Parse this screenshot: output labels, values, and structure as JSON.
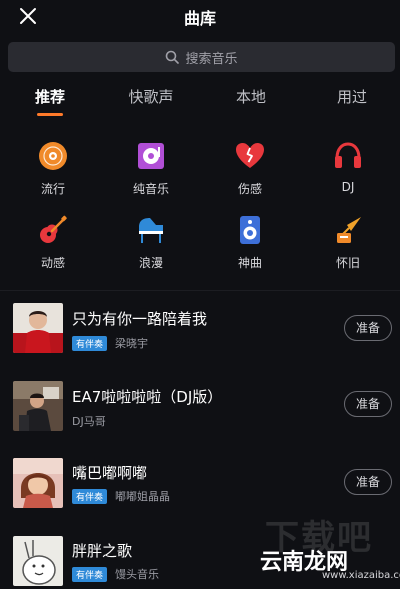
{
  "header": {
    "title": "曲库"
  },
  "search": {
    "placeholder": "搜索音乐"
  },
  "tabs": [
    {
      "label": "推荐",
      "active": true
    },
    {
      "label": "快歌声",
      "active": false
    },
    {
      "label": "本地",
      "active": false
    },
    {
      "label": "用过",
      "active": false
    }
  ],
  "colors": {
    "accent": "#ff7a2a",
    "badge": "#2f8ad8",
    "background": "#0f1014"
  },
  "genres": [
    {
      "label": "流行",
      "icon": "record-disc-icon"
    },
    {
      "label": "纯音乐",
      "icon": "music-album-icon"
    },
    {
      "label": "伤感",
      "icon": "broken-heart-icon"
    },
    {
      "label": "DJ",
      "icon": "headphones-icon"
    },
    {
      "label": "动感",
      "icon": "guitar-icon"
    },
    {
      "label": "浪漫",
      "icon": "piano-icon"
    },
    {
      "label": "神曲",
      "icon": "speaker-icon"
    },
    {
      "label": "怀旧",
      "icon": "gramophone-icon"
    }
  ],
  "songs": [
    {
      "title": "只为有你一路陪着我",
      "badge": "有伴奏",
      "artist": "梁晓宇",
      "action": "准备"
    },
    {
      "title": "EA7啦啦啦啦（DJ版）",
      "badge": "",
      "artist": "DJ马哥",
      "action": "准备"
    },
    {
      "title": "嘴巴嘟啊嘟",
      "badge": "有伴奏",
      "artist": "嘟嘟姐晶晶",
      "action": "准备"
    },
    {
      "title": "胖胖之歌",
      "badge": "有伴奏",
      "artist": "馒头音乐",
      "action": ""
    }
  ],
  "watermark": {
    "brand": "下载吧",
    "site": "云南龙网",
    "url": "www.xiazaiba.com"
  }
}
